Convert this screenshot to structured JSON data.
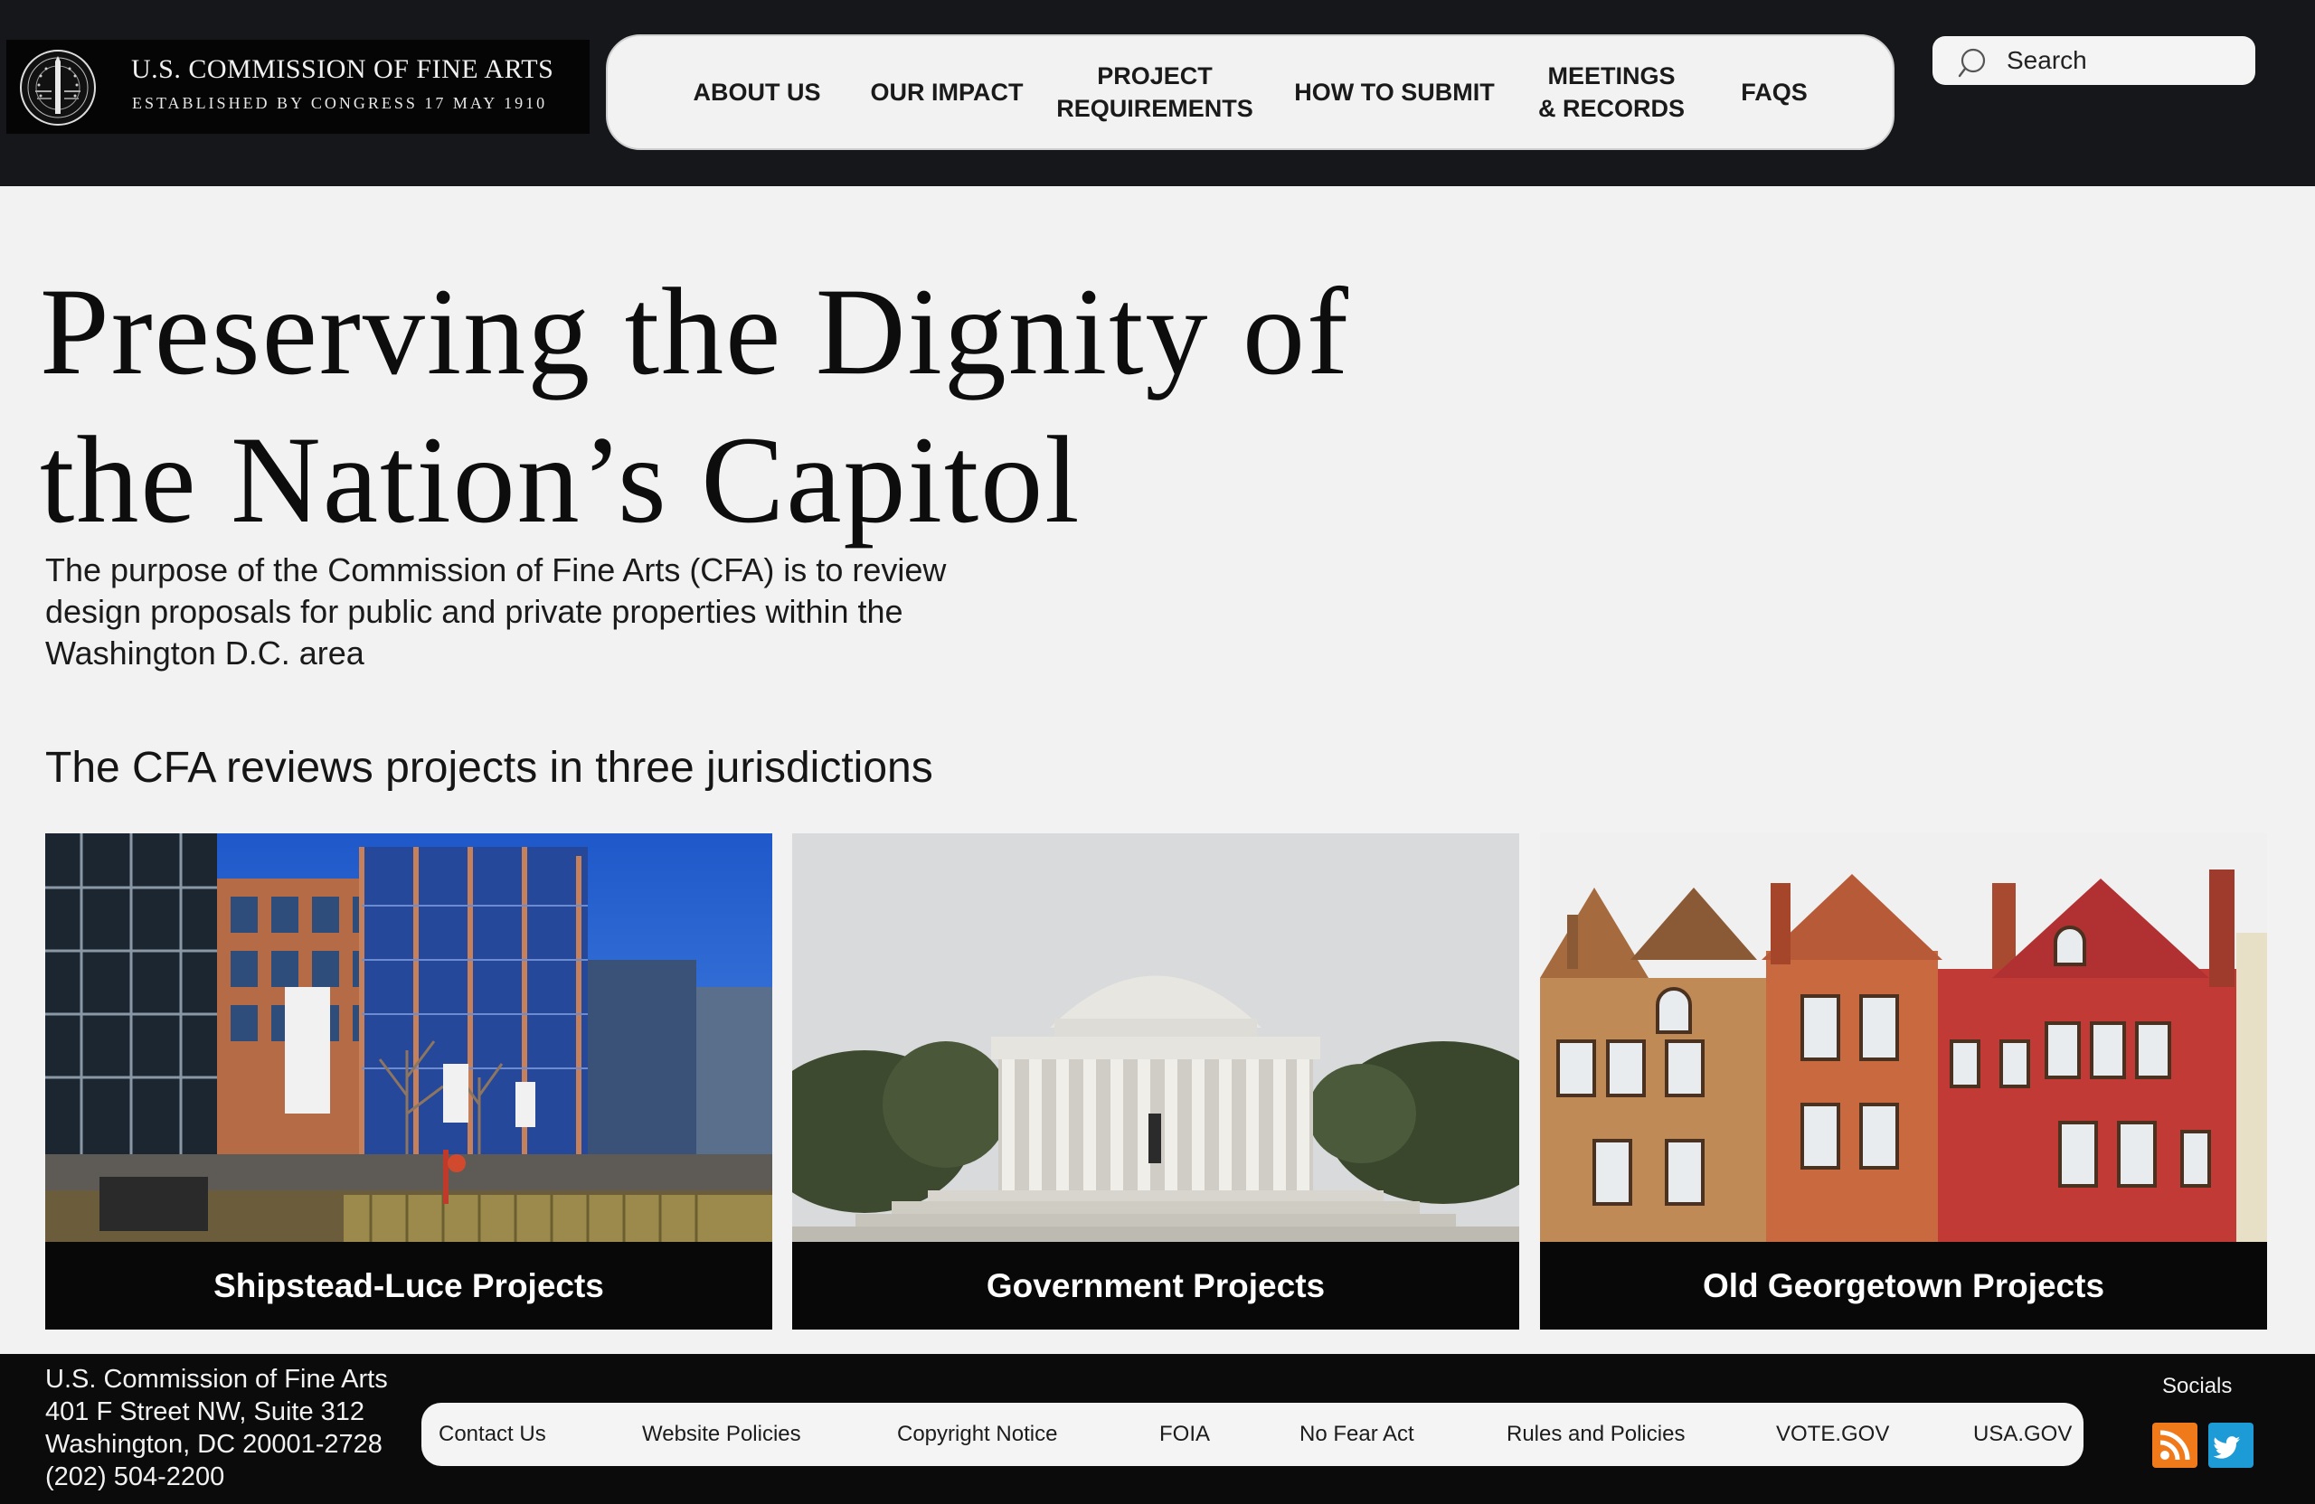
{
  "header": {
    "logo_title": "U.S. COMMISSION OF FINE ARTS",
    "logo_subtitle": "ESTABLISHED BY CONGRESS 17 MAY 1910",
    "nav": [
      {
        "label": "ABOUT US"
      },
      {
        "label": "OUR IMPACT"
      },
      {
        "label": "PROJECT\nREQUIREMENTS"
      },
      {
        "label": "HOW TO SUBMIT"
      },
      {
        "label": "MEETINGS\n& RECORDS"
      },
      {
        "label": "FAQS"
      }
    ],
    "search": {
      "placeholder": "Search",
      "icon": "search-icon"
    }
  },
  "hero": {
    "title": "Preserving the Dignity of the Nation’s Capitol",
    "description": "The purpose of the Commission of Fine Arts (CFA) is to review design proposals for public and private properties within the Washington D.C. area",
    "section_heading": "The CFA reviews projects in three jurisdictions"
  },
  "cards": [
    {
      "label": "Shipstead-Luce Projects",
      "image": "waterfront buildings photo"
    },
    {
      "label": "Government Projects",
      "image": "memorial rotunda photo"
    },
    {
      "label": "Old Georgetown Projects",
      "image": "row houses photo"
    }
  ],
  "footer": {
    "address": [
      "U.S. Commission of Fine Arts",
      "401 F Street NW, Suite 312",
      "Washington, DC 20001-2728",
      "(202) 504-2200"
    ],
    "links": [
      {
        "label": "Contact Us"
      },
      {
        "label": "Website Policies"
      },
      {
        "label": "Copyright Notice"
      },
      {
        "label": "FOIA"
      },
      {
        "label": "No Fear Act"
      },
      {
        "label": "Rules and Policies"
      },
      {
        "label": "VOTE.GOV"
      },
      {
        "label": "USA.GOV"
      }
    ],
    "socials_label": "Socials",
    "socials": [
      {
        "icon": "rss-icon",
        "color": "#f07a1a"
      },
      {
        "icon": "twitter-icon",
        "color": "#1d9bd7"
      }
    ]
  },
  "colors": {
    "header_bg": "#15171b",
    "page_bg": "#f2f2f2",
    "card_label_bg": "#080808",
    "footer_bg": "#0b0b0b"
  }
}
